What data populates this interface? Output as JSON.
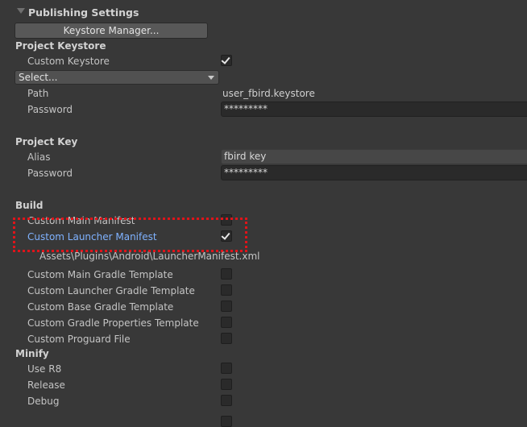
{
  "header": {
    "title": "Publishing Settings"
  },
  "keystore_manager_button": "Keystore Manager...",
  "project_keystore": {
    "heading": "Project Keystore",
    "custom_keystore_label": "Custom Keystore",
    "custom_keystore_checked": true,
    "select_value": "Select...",
    "path_label": "Path",
    "path_value": "user_fbird.keystore",
    "password_label": "Password",
    "password_value": "*********"
  },
  "project_key": {
    "heading": "Project Key",
    "alias_label": "Alias",
    "alias_value": "fbird key",
    "password_label": "Password",
    "password_value": "*********"
  },
  "build": {
    "heading": "Build",
    "items": [
      {
        "label": "Custom Main Manifest",
        "checked": false
      },
      {
        "label": "Custom Launcher Manifest",
        "checked": true
      },
      {
        "label": "Custom Main Gradle Template",
        "checked": false
      },
      {
        "label": "Custom Launcher Gradle Template",
        "checked": false
      },
      {
        "label": "Custom Base Gradle Template",
        "checked": false
      },
      {
        "label": "Custom Gradle Properties Template",
        "checked": false
      },
      {
        "label": "Custom Proguard File",
        "checked": false
      }
    ],
    "launcher_manifest_path": "Assets\\Plugins\\Android\\LauncherManifest.xml"
  },
  "minify": {
    "heading": "Minify",
    "items": [
      {
        "label": "Use R8",
        "checked": false
      },
      {
        "label": "Release",
        "checked": false
      },
      {
        "label": "Debug",
        "checked": false
      }
    ]
  },
  "colors": {
    "background": "#383838",
    "highlight_label": "#7fb2ff",
    "annotation_box": "#e0141a"
  }
}
